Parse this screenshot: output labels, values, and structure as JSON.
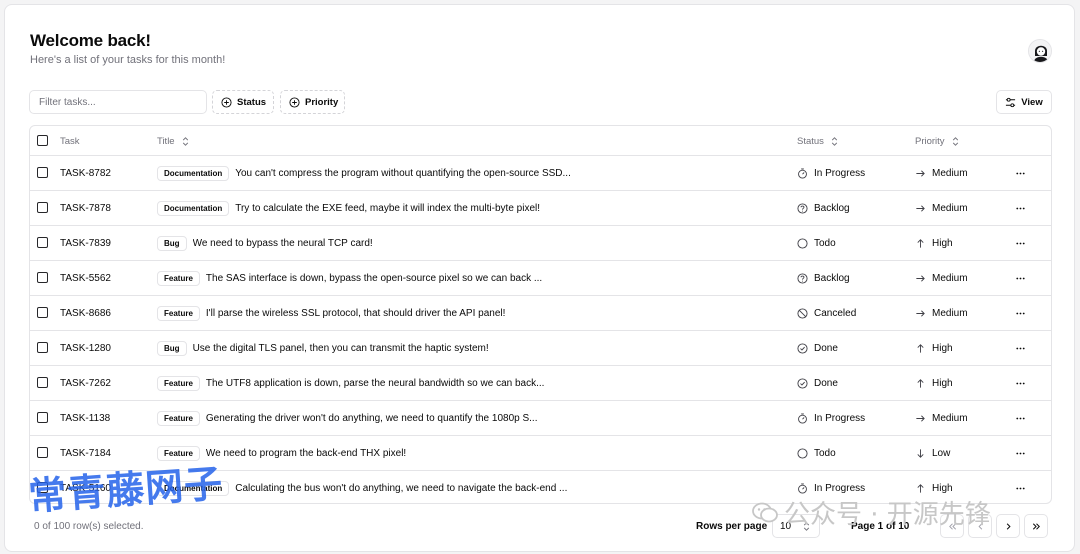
{
  "header": {
    "title": "Welcome back!",
    "subtitle": "Here's a list of your tasks for this month!"
  },
  "toolbar": {
    "filter_placeholder": "Filter tasks...",
    "status_label": "Status",
    "priority_label": "Priority",
    "view_label": "View"
  },
  "table": {
    "columns": {
      "task": "Task",
      "title": "Title",
      "status": "Status",
      "priority": "Priority"
    },
    "rows": [
      {
        "id": "TASK-8782",
        "label": "Documentation",
        "title": "You can't compress the program without quantifying the open-source SSD...",
        "status": "In Progress",
        "status_icon": "timer-icon",
        "priority": "Medium",
        "priority_icon": "arrow-right-icon"
      },
      {
        "id": "TASK-7878",
        "label": "Documentation",
        "title": "Try to calculate the EXE feed, maybe it will index the multi-byte pixel!",
        "status": "Backlog",
        "status_icon": "question-circle-icon",
        "priority": "Medium",
        "priority_icon": "arrow-right-icon"
      },
      {
        "id": "TASK-7839",
        "label": "Bug",
        "title": "We need to bypass the neural TCP card!",
        "status": "Todo",
        "status_icon": "circle-icon",
        "priority": "High",
        "priority_icon": "arrow-up-icon"
      },
      {
        "id": "TASK-5562",
        "label": "Feature",
        "title": "The SAS interface is down, bypass the open-source pixel so we can back ...",
        "status": "Backlog",
        "status_icon": "question-circle-icon",
        "priority": "Medium",
        "priority_icon": "arrow-right-icon"
      },
      {
        "id": "TASK-8686",
        "label": "Feature",
        "title": "I'll parse the wireless SSL protocol, that should driver the API panel!",
        "status": "Canceled",
        "status_icon": "circle-slash-icon",
        "priority": "Medium",
        "priority_icon": "arrow-right-icon"
      },
      {
        "id": "TASK-1280",
        "label": "Bug",
        "title": "Use the digital TLS panel, then you can transmit the haptic system!",
        "status": "Done",
        "status_icon": "check-circle-icon",
        "priority": "High",
        "priority_icon": "arrow-up-icon"
      },
      {
        "id": "TASK-7262",
        "label": "Feature",
        "title": "The UTF8 application is down, parse the neural bandwidth so we can back...",
        "status": "Done",
        "status_icon": "check-circle-icon",
        "priority": "High",
        "priority_icon": "arrow-up-icon"
      },
      {
        "id": "TASK-1138",
        "label": "Feature",
        "title": "Generating the driver won't do anything, we need to quantify the 1080p S...",
        "status": "In Progress",
        "status_icon": "timer-icon",
        "priority": "Medium",
        "priority_icon": "arrow-right-icon"
      },
      {
        "id": "TASK-7184",
        "label": "Feature",
        "title": "We need to program the back-end THX pixel!",
        "status": "Todo",
        "status_icon": "circle-icon",
        "priority": "Low",
        "priority_icon": "arrow-down-icon"
      },
      {
        "id": "TASK-5160",
        "label": "Documentation",
        "title": "Calculating the bus won't do anything, we need to navigate the back-end ...",
        "status": "In Progress",
        "status_icon": "timer-icon",
        "priority": "High",
        "priority_icon": "arrow-up-icon"
      }
    ]
  },
  "footer": {
    "selected_text": "0 of 100 row(s) selected.",
    "rows_per_page_label": "Rows per page",
    "rows_per_page_value": "10",
    "page_indicator": "Page 1 of 10"
  },
  "watermark": {
    "left_text": "常青藤网子",
    "right_text": "公众号 · 开源先锋"
  },
  "colors": {
    "border": "#e4e4e7",
    "muted_text": "#71717a",
    "text": "#0a0a0a",
    "watermark_blue": "#2563eb"
  }
}
